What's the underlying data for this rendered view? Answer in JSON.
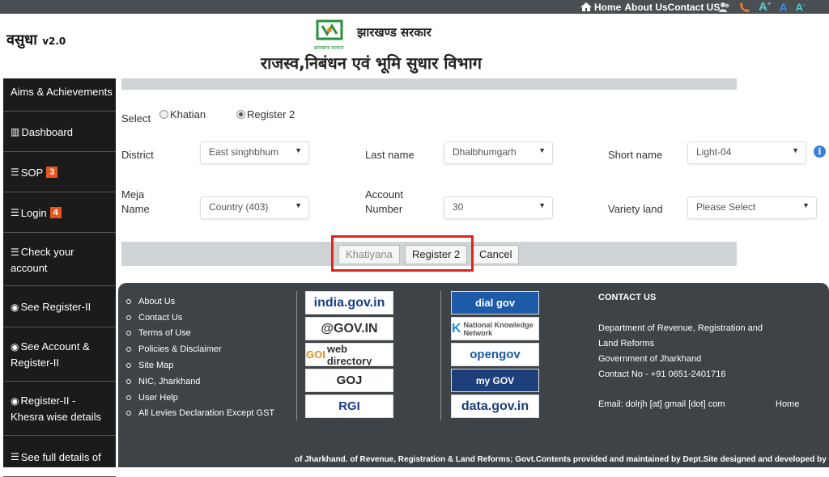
{
  "topnav": {
    "home": "Home",
    "about": "About Us",
    "contact": "Contact US"
  },
  "topicons": [
    "user-icon",
    "phone-icon",
    "text-size-icon",
    "text-size-icon",
    "text-size-icon"
  ],
  "header": {
    "brand": "वसुधा",
    "version": "v2.0",
    "gov_name": "झारखण्ड सरकार",
    "logo_caption": "झारखण्ड सरकार",
    "dept_name": "राजस्व,निबंधन एवं भूमि सुधार  विभाग"
  },
  "sidebar": {
    "items": [
      {
        "label": "Aims & Achievements",
        "icon": ""
      },
      {
        "label": "Dashboard",
        "icon": "bar-chart-icon"
      },
      {
        "label": "SOP",
        "icon": "list-icon",
        "badge": "3"
      },
      {
        "label": "Login",
        "icon": "list-icon",
        "badge": "4"
      },
      {
        "label": "Check your account",
        "icon": "list-icon"
      },
      {
        "label": "See Register-II",
        "icon": "eye-icon"
      },
      {
        "label": "See Account & Register-II",
        "icon": "eye-icon"
      },
      {
        "label": "Register-II - Khesra wise details",
        "icon": "eye-icon"
      },
      {
        "label": "See full details of",
        "icon": "list-icon"
      }
    ]
  },
  "form": {
    "select_label": "Select",
    "radio1": "Khatian",
    "radio2": "Register 2",
    "district_label": "District",
    "district_value": "East singhbhum",
    "lastname_label": "Last name",
    "lastname_value": "Dhalbhumgarh",
    "shortname_label": "Short name",
    "shortname_value": "Light-04",
    "meja_label_1": "Meja",
    "meja_label_2": "Name",
    "meja_value": "Country (403)",
    "account_label_1": "Account",
    "account_label_2": "Number",
    "account_value": "30",
    "variety_label": "Variety land",
    "variety_value": "Please Select"
  },
  "buttons": {
    "khatiyana": "Khatiyana",
    "register2": "Register 2",
    "cancel": "Cancel"
  },
  "footer": {
    "links": [
      "About Us",
      "Contact Us",
      "Terms of Use",
      "Policies & Disclaimer",
      "Site Map",
      "NIC, Jharkhand",
      "User Help",
      "All Levies Declaration Except GST"
    ],
    "logos_left": [
      "india.gov.in",
      "@GOV.IN",
      "web directory",
      "GOJ",
      "RGI"
    ],
    "logos_right": [
      "dial gov",
      "National Knowledge Network",
      "opengov",
      "my GOV",
      "data.gov.in"
    ],
    "contact_title": "CONTACT US",
    "contact_lines": [
      "Department of Revenue, Registration and",
      "Land Reforms",
      "Government of Jharkhand",
      "Contact No - +91 0651-2401716"
    ],
    "email": "Email: dolrjh [at] gmail [dot] com",
    "home": "Home",
    "bottom_text": "of Jharkhand.  of Revenue, Registration & Land Reforms; Govt.Contents provided and maintained by Dept.Site designed and developed by NIC."
  }
}
